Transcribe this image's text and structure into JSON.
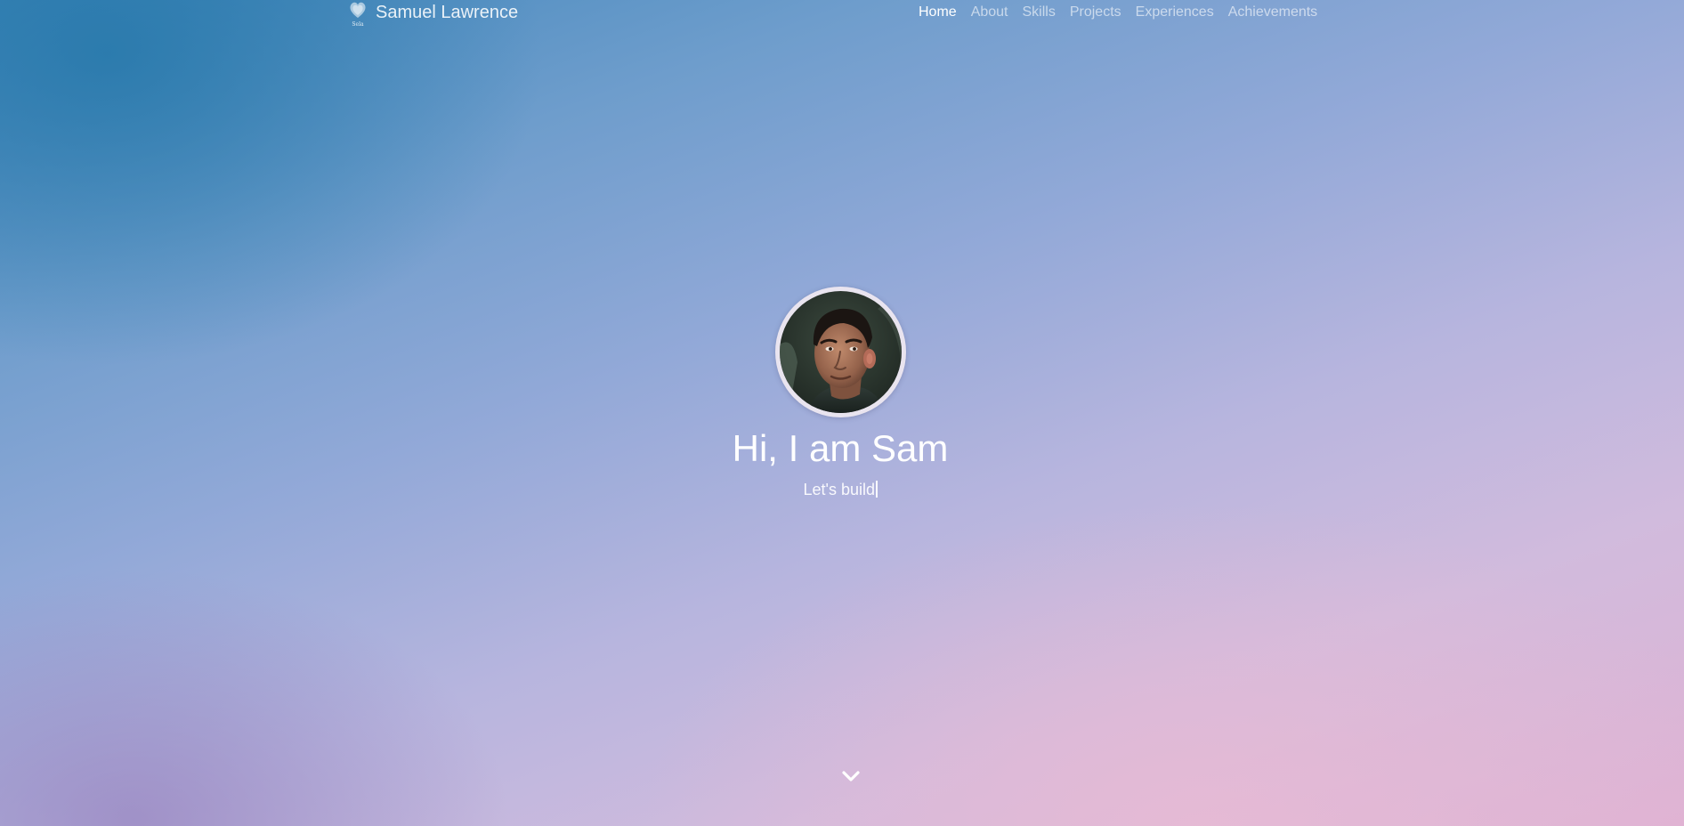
{
  "navbar": {
    "brand_name": "Samuel Lawrence",
    "logo_caption": "Sela",
    "links": [
      {
        "label": "Home",
        "active": true
      },
      {
        "label": "About",
        "active": false
      },
      {
        "label": "Skills",
        "active": false
      },
      {
        "label": "Projects",
        "active": false
      },
      {
        "label": "Experiences",
        "active": false
      },
      {
        "label": "Achievements",
        "active": false
      }
    ]
  },
  "hero": {
    "title": "Hi, I am Sam",
    "subtitle": "Let's build",
    "avatar_icon": "profile-photo",
    "scroll_icon": "chevron-down-icon"
  },
  "colors": {
    "text": "#ffffff",
    "nav_inactive": "rgba(255,255,255,0.6)",
    "gradient_top_left": "#2e7db4",
    "gradient_bottom_right": "#e3b4d4"
  }
}
